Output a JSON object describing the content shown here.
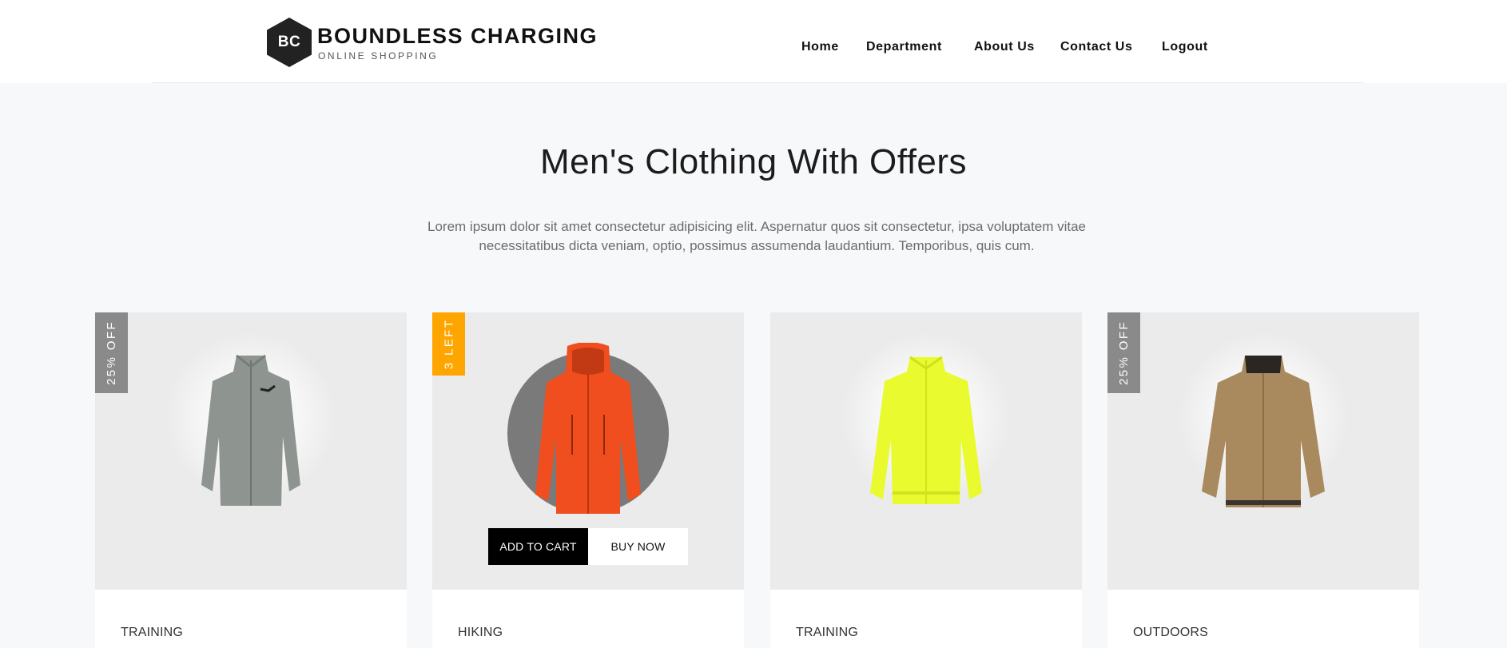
{
  "brand": {
    "initials": "BC",
    "name": "BOUNDLESS CHARGING",
    "tagline": "ONLINE SHOPPING"
  },
  "nav": {
    "items": [
      {
        "label": "Home"
      },
      {
        "label": "Department"
      },
      {
        "label": "About Us"
      },
      {
        "label": "Contact Us"
      },
      {
        "label": "Logout"
      }
    ]
  },
  "section": {
    "title": "Men's Clothing With Offers",
    "description": "Lorem ipsum dolor sit amet consectetur adipisicing elit. Aspernatur quos sit consectetur, ipsa voluptatem vitae necessitatibus dicta veniam, optio, possimus assumenda laudantium. Temporibus, quis cum."
  },
  "products": [
    {
      "badge": "25% OFF",
      "badge_color": "#8a8a8a",
      "category": "TRAINING",
      "product_color": "#8e9490",
      "icon": "jacket-icon"
    },
    {
      "badge": "3 LEFT",
      "badge_color": "#ffa500",
      "category": "HIKING",
      "product_color": "#f04e1e",
      "icon": "jacket-icon",
      "add_to_cart_label": "ADD TO CART",
      "buy_now_label": "BUY NOW"
    },
    {
      "badge": "",
      "category": "TRAINING",
      "product_color": "#e9fb2e",
      "icon": "jacket-icon"
    },
    {
      "badge": "25% OFF",
      "badge_color": "#8a8a8a",
      "category": "OUTDOORS",
      "product_color": "#a88a5e",
      "icon": "jacket-icon"
    }
  ],
  "colors": {
    "page_background": "#f7f8f9",
    "card_image_background": "#ebebeb",
    "offer_badge": "#8a8a8a",
    "stock_badge": "#ffa500",
    "primary_button": "#000000"
  }
}
